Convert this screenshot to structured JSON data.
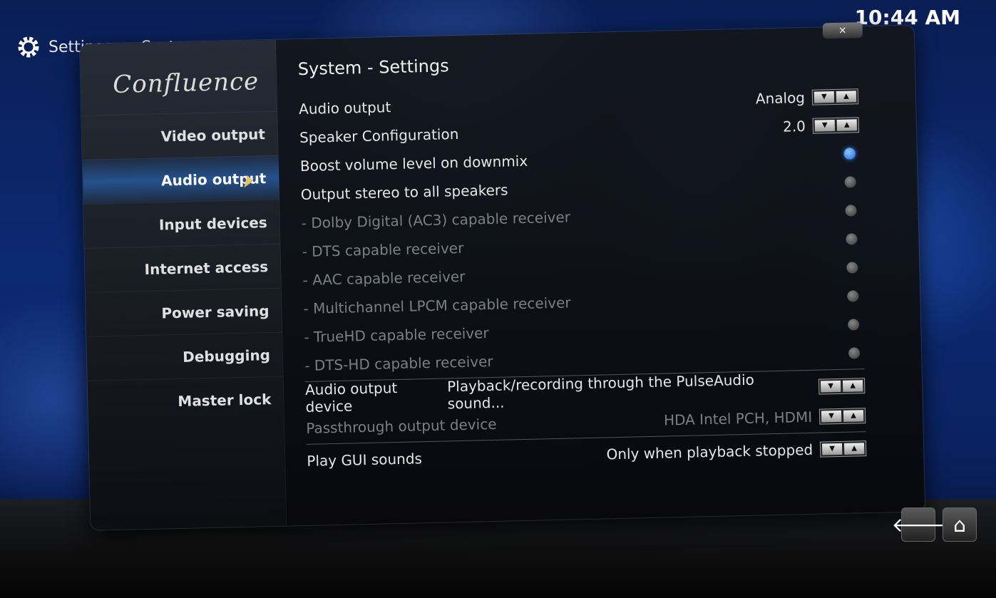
{
  "header": {
    "section": "Settings",
    "subsection": "System",
    "clock": "10:44 AM"
  },
  "panel": {
    "heading": "System - Settings",
    "close_label": "×",
    "logo": "Confluence"
  },
  "sidebar": {
    "items": [
      {
        "label": "Video output"
      },
      {
        "label": "Audio output"
      },
      {
        "label": "Input devices"
      },
      {
        "label": "Internet access"
      },
      {
        "label": "Power saving"
      },
      {
        "label": "Debugging"
      },
      {
        "label": "Master lock"
      }
    ]
  },
  "settings": {
    "rows": [
      {
        "label": "Audio output",
        "value": "Analog"
      },
      {
        "label": "Speaker Configuration",
        "value": "2.0"
      },
      {
        "label": "Boost volume level on downmix"
      },
      {
        "label": "Output stereo to all speakers"
      },
      {
        "label": "- Dolby Digital (AC3) capable receiver"
      },
      {
        "label": "- DTS capable receiver"
      },
      {
        "label": "- AAC capable receiver"
      },
      {
        "label": "- Multichannel LPCM capable receiver"
      },
      {
        "label": "- TrueHD capable receiver"
      },
      {
        "label": "- DTS-HD capable receiver"
      },
      {
        "label": "Audio output device",
        "value": "Playback/recording through the PulseAudio sound..."
      },
      {
        "label": "Passthrough output device",
        "value": "HDA Intel PCH, HDMI"
      },
      {
        "label": "Play GUI sounds",
        "value": "Only when playback stopped"
      }
    ],
    "spin_labels": {
      "down": "▼",
      "up": "▲"
    }
  },
  "nav": {
    "back_glyph": "🡐",
    "home_glyph": "⌂"
  }
}
